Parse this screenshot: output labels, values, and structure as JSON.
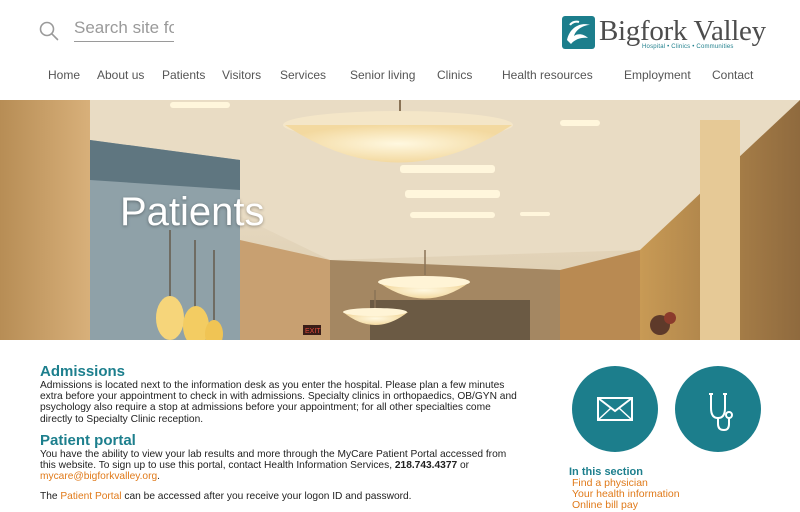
{
  "header": {
    "search_placeholder": "Search site fo",
    "logo_name": "Bigfork Valley",
    "logo_tagline": "Hospital • Clinics • Communities"
  },
  "nav": {
    "items": [
      {
        "label": "Home"
      },
      {
        "label": "About us"
      },
      {
        "label": "Patients"
      },
      {
        "label": "Visitors"
      },
      {
        "label": "Services"
      },
      {
        "label": "Senior living"
      },
      {
        "label": "Clinics"
      },
      {
        "label": "Health resources"
      },
      {
        "label": "Employment"
      },
      {
        "label": "Contact"
      }
    ]
  },
  "hero": {
    "title": "Patients"
  },
  "admissions": {
    "heading": "Admissions",
    "line1": "Admissions is located next to the information desk as you enter the hospital. Please plan a few minutes",
    "line2": "extra before your appointment to check in with admissions. Specialty clinics in orthopaedics, OB/GYN and",
    "line3": "psychology also require a stop at admissions before your appointment; for all other specialties come",
    "line4": "directly to Specialty Clinic reception."
  },
  "portal": {
    "heading": "Patient portal",
    "line1": "You have the ability to view your lab results and more through the MyCare Patient Portal accessed from",
    "line2_before": "this website. To sign up to use this portal, contact Health Information Services, ",
    "phone": "218.743.4377",
    "line2_after": " or",
    "email": "mycare@bigforkvalley.org",
    "email_after": ".",
    "line3_before": "The ",
    "portal_link": "Patient Portal",
    "line3_after": " can be accessed after you receive your logon ID and password."
  },
  "side": {
    "heading": "In this section",
    "links": [
      {
        "label": "Find a physician"
      },
      {
        "label": "Your health information"
      },
      {
        "label": "Online bill pay"
      }
    ],
    "icons": [
      "envelope-icon",
      "stethoscope-icon"
    ]
  },
  "colors": {
    "accent": "#1c7e8c",
    "link": "#e07a1a",
    "nav_text": "#555555"
  }
}
